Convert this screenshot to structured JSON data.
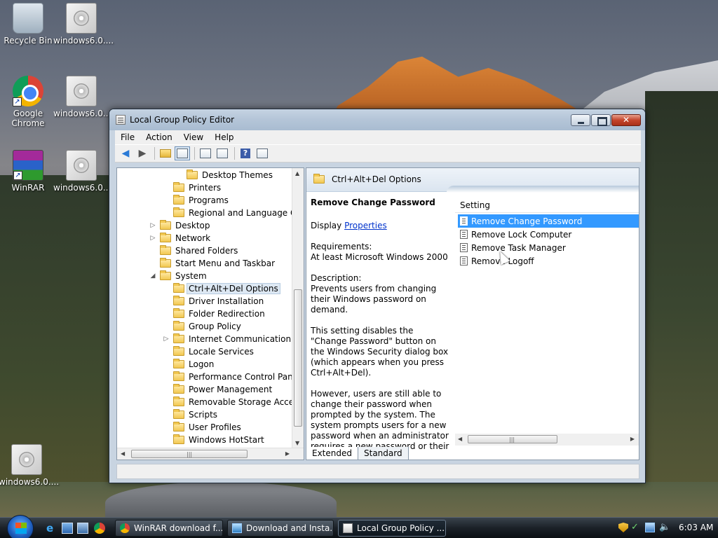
{
  "desktop": {
    "icons": [
      {
        "label": "Recycle Bin",
        "icon": "recycle-bin-icon"
      },
      {
        "label": "windows6.0....",
        "icon": "package-file-icon"
      },
      {
        "label": "Google Chrome",
        "icon": "chrome-icon"
      },
      {
        "label": "windows6.0....",
        "icon": "package-file-icon"
      },
      {
        "label": "WinRAR",
        "icon": "winrar-icon"
      },
      {
        "label": "windows6.0....",
        "icon": "package-file-icon"
      },
      {
        "label": "windows6.0....",
        "icon": "package-file-icon"
      }
    ]
  },
  "window": {
    "title": "Local Group Policy Editor",
    "menu": [
      "File",
      "Action",
      "View",
      "Help"
    ]
  },
  "tree": {
    "items": [
      {
        "label": "Desktop Themes"
      },
      {
        "label": "Printers"
      },
      {
        "label": "Programs"
      },
      {
        "label": "Regional and Language Opt"
      },
      {
        "label": "Desktop",
        "expander": "▷"
      },
      {
        "label": "Network",
        "expander": "▷"
      },
      {
        "label": "Shared Folders"
      },
      {
        "label": "Start Menu and Taskbar"
      },
      {
        "label": "System",
        "expander": "◢"
      },
      {
        "label": "Ctrl+Alt+Del Options"
      },
      {
        "label": "Driver Installation"
      },
      {
        "label": "Folder Redirection"
      },
      {
        "label": "Group Policy"
      },
      {
        "label": "Internet Communication M",
        "expander": "▷"
      },
      {
        "label": "Locale Services"
      },
      {
        "label": "Logon"
      },
      {
        "label": "Performance Control Panel"
      },
      {
        "label": "Power Management"
      },
      {
        "label": "Removable Storage Access"
      },
      {
        "label": "Scripts"
      },
      {
        "label": "User Profiles"
      },
      {
        "label": "Windows HotStart"
      }
    ]
  },
  "right": {
    "header_title": "Ctrl+Alt+Del Options",
    "desc_heading": "Remove Change Password",
    "display_prefix": "Display",
    "properties_link": "Properties",
    "requirements_label": "Requirements:",
    "requirements_value": "At least Microsoft Windows 2000",
    "description_label": "Description:",
    "description_1": "Prevents users from changing their Windows password on demand.",
    "description_2": "This setting disables the \"Change Password\" button on the Windows Security dialog box (which appears when you press Ctrl+Alt+Del).",
    "description_3": "However, users are still able to change their password when prompted by the system. The system prompts users for a new password when an administrator requires a new password or their password is expiring.",
    "column_setting": "Setting",
    "settings": [
      {
        "label": "Remove Change Password"
      },
      {
        "label": "Remove Lock Computer"
      },
      {
        "label": "Remove Task Manager"
      },
      {
        "label": "Remove Logoff"
      }
    ],
    "tabs": [
      "Extended",
      "Standard"
    ]
  },
  "taskbar": {
    "buttons": [
      {
        "label": "WinRAR download f..."
      },
      {
        "label": "Download and Insta..."
      },
      {
        "label": "Local Group Policy ..."
      }
    ],
    "clock": "6:03 AM"
  }
}
